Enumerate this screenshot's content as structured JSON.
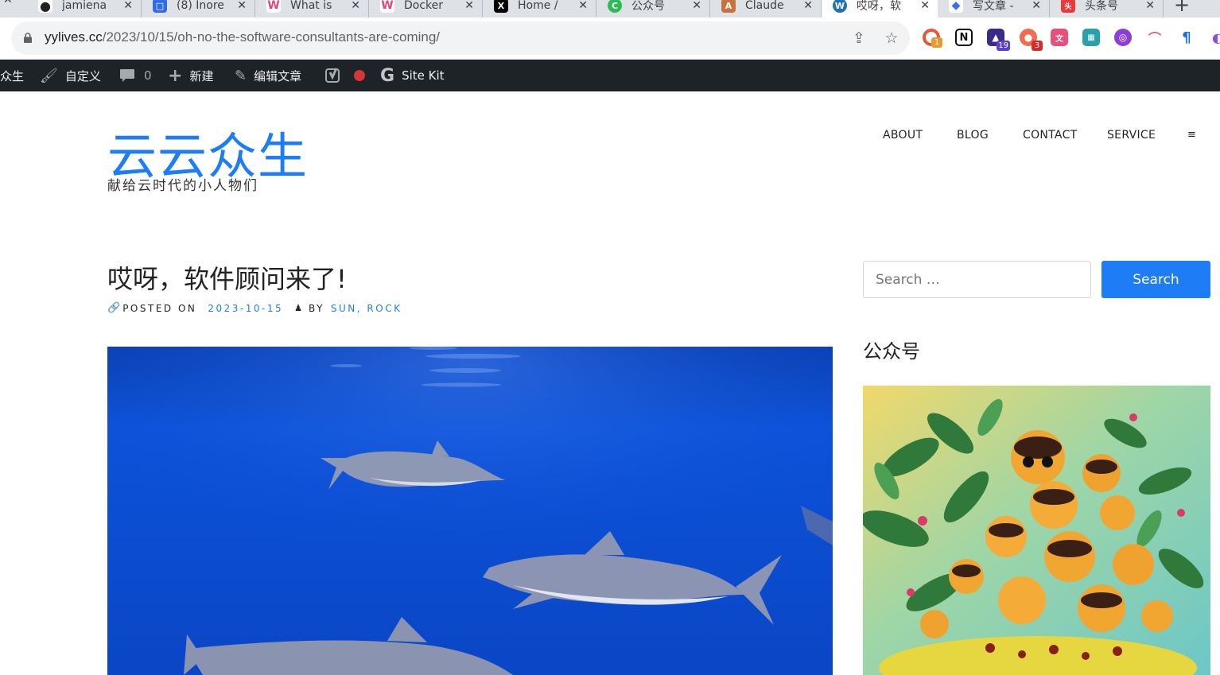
{
  "browser": {
    "tabs": [
      {
        "title": "jamiena",
        "icon": "github-icon"
      },
      {
        "title": "(8) Inore",
        "icon": "blue-app-icon"
      },
      {
        "title": "What is",
        "icon": "webflow-icon"
      },
      {
        "title": "Docker",
        "icon": "webflow-icon"
      },
      {
        "title": "Home /",
        "icon": "x-icon"
      },
      {
        "title": "公众号",
        "icon": "green-c-icon"
      },
      {
        "title": "Claude",
        "icon": "anthropic-icon"
      },
      {
        "title": "哎呀，软",
        "icon": "wordpress-icon",
        "active": true
      },
      {
        "title": "写文章 -",
        "icon": "diamond-icon"
      },
      {
        "title": "头条号",
        "icon": "toutiao-icon"
      }
    ],
    "url_domain": "yylives.cc",
    "url_path": "/2023/10/15/oh-no-the-software-consultants-are-coming/",
    "extension_badges": {
      "first": "1",
      "third": "19",
      "fourth": "3"
    }
  },
  "adminbar": {
    "site_name": "众生",
    "customize": "自定义",
    "comments_count": "0",
    "new": "新建",
    "edit_post": "编辑文章",
    "sitekit": "Site Kit"
  },
  "site": {
    "title": "云云众生",
    "description": "献给云时代的小人物们",
    "menu": [
      "ABOUT",
      "BLOG",
      "CONTACT",
      "SERVICE"
    ],
    "menu_toggle": "≡"
  },
  "post": {
    "title": "哎呀，软件顾问来了!",
    "posted_on_label": "POSTED ON",
    "date": "2023-10-15",
    "by_label": "BY",
    "authors": "SUN, ROCK"
  },
  "sidebar": {
    "search_placeholder": "Search …",
    "search_button": "Search",
    "widget_title": "公众号"
  },
  "colors": {
    "accent": "#1e7df6",
    "adminbar": "#1d2327",
    "tabstrip": "#dee1e6"
  }
}
